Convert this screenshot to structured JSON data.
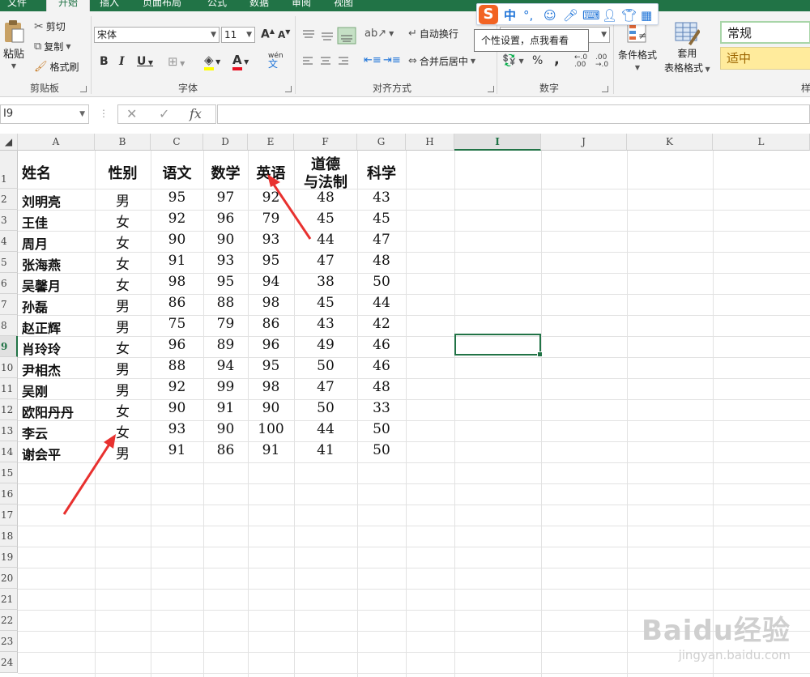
{
  "tabs": [
    "文件",
    "开始",
    "插入",
    "页面布局",
    "公式",
    "数据",
    "审阅",
    "视图"
  ],
  "ribbon": {
    "clipboard": {
      "paste": "粘贴",
      "cut": "剪切",
      "copy": "复制",
      "format_painter": "格式刷",
      "group_label": "剪贴板"
    },
    "font": {
      "font_name": "宋体",
      "font_size": "11",
      "grow": "A",
      "shrink": "A",
      "bold": "B",
      "italic": "I",
      "underline": "U",
      "font_color_letter": "A",
      "phonetic": "wén",
      "group_label": "字体"
    },
    "alignment": {
      "wrap_text": "自动换行",
      "merge_center": "合并后居中",
      "group_label": "对齐方式"
    },
    "number": {
      "percent": "%",
      "comma": ",",
      "group_label": "数字"
    },
    "styles": {
      "conditional_format": "条件格式",
      "table_format_line1": "套用",
      "table_format_line2": "表格格式",
      "style_normal": "常规",
      "style_neutral": "适中",
      "partial_label": "样"
    }
  },
  "ime": {
    "mode": "中",
    "tooltip": "个性设置，点我看看"
  },
  "formula_bar": {
    "name_box": "I9",
    "fx": "fx",
    "cancel": "✕",
    "enter": "✓",
    "formula": ""
  },
  "sheet": {
    "columns": [
      "A",
      "B",
      "C",
      "D",
      "E",
      "F",
      "G",
      "H",
      "I",
      "J",
      "K",
      "L"
    ],
    "selected_column": "I",
    "selected_row": "9",
    "headers": [
      "姓名",
      "性别",
      "语文",
      "数学",
      "英语",
      "道德",
      "与法制",
      "科学"
    ],
    "rows": [
      [
        "刘明亮",
        "男",
        "95",
        "97",
        "92",
        "48",
        "43"
      ],
      [
        "王佳",
        "女",
        "92",
        "96",
        "79",
        "45",
        "45"
      ],
      [
        "周月",
        "女",
        "90",
        "90",
        "93",
        "44",
        "47"
      ],
      [
        "张海燕",
        "女",
        "91",
        "93",
        "95",
        "47",
        "48"
      ],
      [
        "吴馨月",
        "女",
        "98",
        "95",
        "94",
        "38",
        "50"
      ],
      [
        "孙磊",
        "男",
        "86",
        "88",
        "98",
        "45",
        "44"
      ],
      [
        "赵正辉",
        "男",
        "75",
        "79",
        "86",
        "43",
        "42"
      ],
      [
        "肖玲玲",
        "女",
        "96",
        "89",
        "96",
        "49",
        "46"
      ],
      [
        "尹相杰",
        "男",
        "88",
        "94",
        "95",
        "50",
        "46"
      ],
      [
        "吴刚",
        "男",
        "92",
        "99",
        "98",
        "47",
        "48"
      ],
      [
        "欧阳丹丹",
        "女",
        "90",
        "91",
        "90",
        "50",
        "33"
      ],
      [
        "李云",
        "女",
        "93",
        "90",
        "100",
        "44",
        "50"
      ],
      [
        "谢会平",
        "男",
        "91",
        "86",
        "91",
        "41",
        "50"
      ]
    ],
    "row_numbers": [
      "1",
      "2",
      "3",
      "4",
      "5",
      "6",
      "7",
      "8",
      "9",
      "10",
      "11",
      "12",
      "13",
      "14",
      "15",
      "16",
      "17",
      "18",
      "19",
      "20",
      "21",
      "22",
      "23",
      "24"
    ]
  },
  "watermark": {
    "brand": "Baidu经验",
    "url": "jingyan.baidu.com"
  },
  "colors": {
    "excel_green": "#217346",
    "arrow_red": "#e8312f",
    "neutral_fill": "#ffeb9c",
    "neutral_text": "#9c6500"
  }
}
